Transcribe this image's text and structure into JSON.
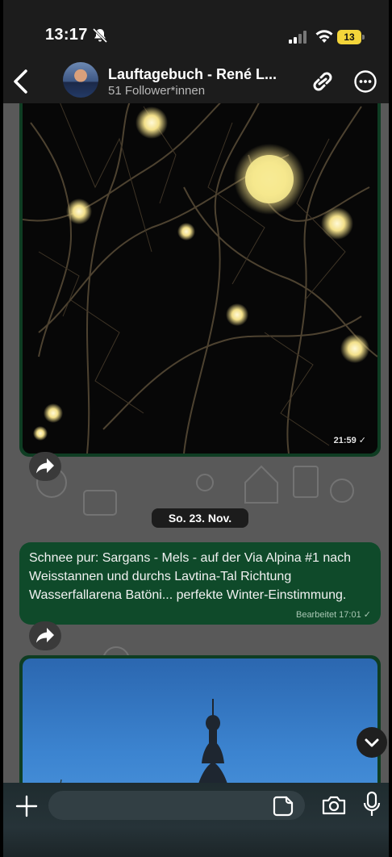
{
  "status_bar": {
    "time": "13:17",
    "battery": "13"
  },
  "header": {
    "title": "Lauftagebuch - René L...",
    "subtitle": "51 Follower*innen"
  },
  "messages": {
    "photo1_time": "21:59 ✓",
    "date_separator": "So. 23. Nov.",
    "text": "Schnee pur: Sargans - Mels - auf der Via Alpina #1 nach Weisstannen und durchs Lavtina-Tal Richtung Wasserfallarena Batöni... perfekte Winter-Einstimmung.",
    "text_meta": "Bearbeitet 17:01 ✓"
  },
  "composer": {
    "placeholder": ""
  },
  "icons": [
    "bell-slash-icon",
    "signal-icon",
    "wifi-icon",
    "back-icon",
    "link-icon",
    "more-icon",
    "share-icon",
    "chevron-down-icon",
    "plus-icon",
    "sticker-icon",
    "camera-icon",
    "mic-icon"
  ],
  "colors": {
    "bubble": "#0f4a2a",
    "bar": "#1c1c1c",
    "chat_bg": "#595959",
    "battery": "#f4d53a"
  }
}
